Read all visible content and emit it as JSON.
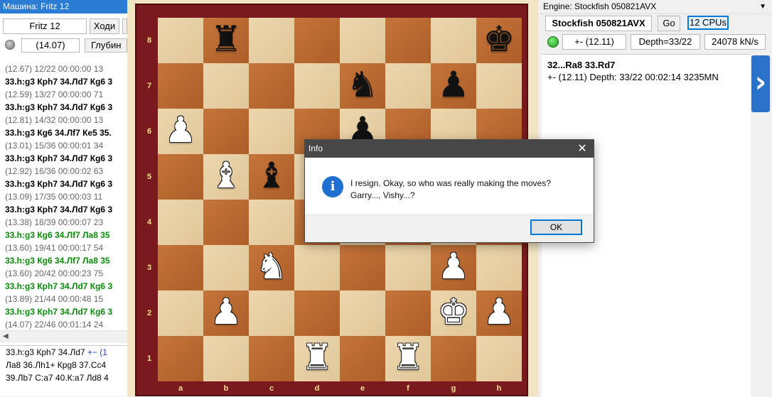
{
  "left_panel": {
    "title": "Машина: Fritz 12",
    "engine_name": "Fritz 12",
    "move_button": "Ходи",
    "eval": "(14.07)",
    "depth_label": "Глубин",
    "lines": [
      {
        "kind": "meta",
        "text": "(12.67)   12/22   00:00:00   13"
      },
      {
        "kind": "moves",
        "text": "33.h:g3 Крh7 34.Лd7 Кg6 3"
      },
      {
        "kind": "meta",
        "text": "(12.59)   13/27   00:00:00   71"
      },
      {
        "kind": "moves",
        "text": "33.h:g3 Крh7 34.Лd7 Кg6 3"
      },
      {
        "kind": "meta",
        "text": "(12.81)   14/32   00:00:00   13"
      },
      {
        "kind": "moves",
        "text": "33.h:g3 Кg6 34.Лf7 Кe5 35."
      },
      {
        "kind": "meta",
        "text": "(13.01)   15/36   00:00:01   34"
      },
      {
        "kind": "moves",
        "text": "33.h:g3 Крh7 34.Лd7 Кg6 3"
      },
      {
        "kind": "meta",
        "text": "(12.92)   16/36   00:00:02   63"
      },
      {
        "kind": "moves",
        "text": "33.h:g3 Крh7 34.Лd7 Кg6 3"
      },
      {
        "kind": "meta",
        "text": "(13.09)   17/35   00:00:03   11"
      },
      {
        "kind": "moves",
        "text": "33.h:g3 Крh7 34.Лd7 Кg6 3"
      },
      {
        "kind": "meta",
        "text": "(13.38)   18/39   00:00:07   23"
      },
      {
        "kind": "moves-green",
        "text": "33.h:g3 Кg6 34.Лf7 Лa8 35"
      },
      {
        "kind": "meta",
        "text": "(13.60)   19/41   00:00:17   54"
      },
      {
        "kind": "moves-green",
        "text": "33.h:g3 Кg6 34.Лf7 Лa8 35"
      },
      {
        "kind": "meta",
        "text": "(13.60)   20/42   00:00:23   75"
      },
      {
        "kind": "moves-green",
        "text": "33.h:g3 Крh7 34.Лd7 Кg6 3"
      },
      {
        "kind": "meta",
        "text": "(13.89)   21/44   00:00:48   15"
      },
      {
        "kind": "moves-green",
        "text": "33.h:g3 Крh7 34.Лd7 Кg6 3"
      },
      {
        "kind": "meta",
        "text": "(14.07)   22/46   00:01:14   24"
      }
    ],
    "bottom": {
      "line1_moves": "33.h:g3  Крh7  34.Лd7",
      "line1_eval": " +− (1",
      "line2": "Лa8  36.Лh1+  Кpg8  37.Cc4",
      "line3": "39.Лb7  C:a7  40.К:a7  Лd8  4"
    }
  },
  "board": {
    "ranks": [
      "8",
      "7",
      "6",
      "5",
      "4",
      "3",
      "2",
      "1"
    ],
    "files": [
      "a",
      "b",
      "c",
      "d",
      "e",
      "f",
      "g",
      "h"
    ],
    "pieces": [
      {
        "square": "b8",
        "glyph": "♜",
        "color": "black",
        "name": "black-rook-icon"
      },
      {
        "square": "h8",
        "glyph": "♚",
        "color": "black",
        "name": "black-king-icon"
      },
      {
        "square": "e7",
        "glyph": "♞",
        "color": "black",
        "name": "black-knight-icon"
      },
      {
        "square": "g7",
        "glyph": "♟",
        "color": "black",
        "name": "black-pawn-icon"
      },
      {
        "square": "a6",
        "glyph": "♟",
        "color": "white",
        "name": "white-pawn-icon"
      },
      {
        "square": "e6",
        "glyph": "♟",
        "color": "black",
        "name": "black-pawn-icon"
      },
      {
        "square": "b5",
        "glyph": "♝",
        "color": "white",
        "name": "white-bishop-icon"
      },
      {
        "square": "c5",
        "glyph": "♝",
        "color": "black",
        "name": "black-bishop-icon"
      },
      {
        "square": "c3",
        "glyph": "♞",
        "color": "white",
        "name": "white-knight-icon"
      },
      {
        "square": "g3",
        "glyph": "♟",
        "color": "white",
        "name": "white-pawn-icon"
      },
      {
        "square": "b2",
        "glyph": "♟",
        "color": "white",
        "name": "white-pawn-icon"
      },
      {
        "square": "g2",
        "glyph": "♚",
        "color": "white",
        "name": "white-king-icon"
      },
      {
        "square": "h2",
        "glyph": "♟",
        "color": "white",
        "name": "white-pawn-icon"
      },
      {
        "square": "d1",
        "glyph": "♜",
        "color": "white",
        "name": "white-rook-icon"
      },
      {
        "square": "f1",
        "glyph": "♜",
        "color": "white",
        "name": "white-rook-icon"
      }
    ]
  },
  "right_panel": {
    "title": "Engine: Stockfish 050821AVX",
    "engine_name": "Stockfish 050821AVX",
    "go_button": "Go",
    "cpus_button": "12 CPUs",
    "eval": "+-   (12.11)",
    "depth": "Depth=33/22",
    "speed": "24078 kN/s",
    "output_line1": "32...Ra8 33.Rd7",
    "output_line2": "+-  (12.11)   Depth: 33/22   00:02:14  3235MN",
    "next_icon": "chevron-right-icon"
  },
  "dialog": {
    "title": "Info",
    "message": "I resign. Okay, so who was really making the moves? Garry..., Vishy...?",
    "ok_label": "OK",
    "close_glyph": "✕",
    "icon_glyph": "i"
  },
  "colors": {
    "titlebar_blue": "#2b7cd3",
    "board_frame": "#7a1a1e",
    "light_square": "#e9cf9f",
    "dark_square": "#c0692b",
    "coord_yellow": "#f4e38c",
    "green_text": "#0a8a0a",
    "dialog_title": "#474747",
    "info_icon_blue": "#1e6fd0",
    "next_button_blue": "#2a72c9"
  }
}
